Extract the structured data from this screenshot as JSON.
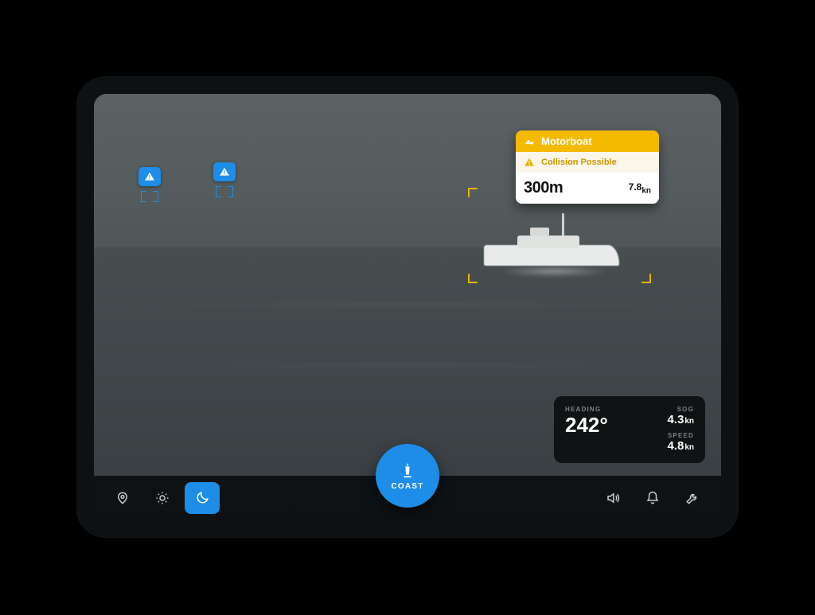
{
  "target_card": {
    "type_label": "Motorboat",
    "warning_label": "Collision Possible",
    "distance": "300m",
    "speed_value": "7.8",
    "speed_unit": "kn"
  },
  "hud": {
    "heading_label": "HEADING",
    "heading_value": "242°",
    "sog_label": "SOG",
    "sog_value": "4.3",
    "sog_unit": "kn",
    "speed_label": "SPEED",
    "speed_value": "4.8",
    "speed_unit": "kn"
  },
  "fab": {
    "label": "COAST"
  },
  "toolbar": {
    "icons": {
      "pin": "pin-icon",
      "sun": "sun-icon",
      "moon": "moon-icon",
      "volume": "volume-icon",
      "bell": "bell-icon",
      "wrench": "wrench-icon"
    },
    "active_mode": "night"
  },
  "contacts": {
    "distant_count": 2
  },
  "colors": {
    "accent": "#1d8de8",
    "warning": "#f4ba00"
  }
}
